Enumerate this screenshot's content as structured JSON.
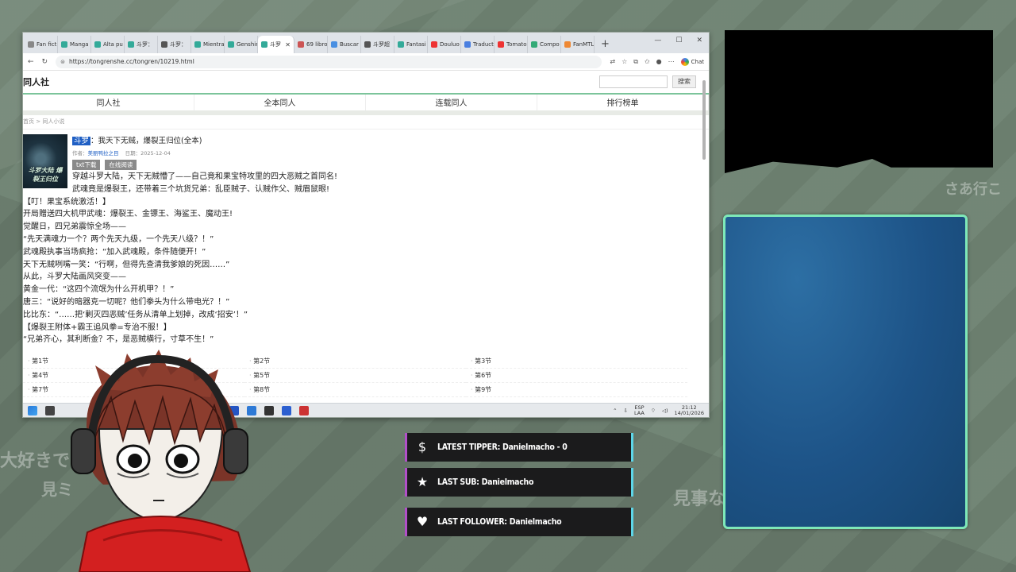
{
  "browser": {
    "tabs": [
      {
        "label": "Fan fict",
        "color": "#888"
      },
      {
        "label": "Manga",
        "color": "#3a9"
      },
      {
        "label": "Alta pu",
        "color": "#3a9"
      },
      {
        "label": "斗罗：",
        "color": "#3a9"
      },
      {
        "label": "斗罗：",
        "color": "#555"
      },
      {
        "label": "Mientra",
        "color": "#3a9"
      },
      {
        "label": "Genshin",
        "color": "#3a9"
      },
      {
        "label": "斗罗",
        "color": "#3a9",
        "active": true
      },
      {
        "label": "69 libro",
        "color": "#c55"
      },
      {
        "label": "Buscar",
        "color": "#4a90e2"
      },
      {
        "label": "斗罗超",
        "color": "#555"
      },
      {
        "label": "Fantasi",
        "color": "#3a9"
      },
      {
        "label": "Douluo",
        "color": "#e33"
      },
      {
        "label": "Traducto",
        "color": "#4a7fe0"
      },
      {
        "label": "Tomato",
        "color": "#e33"
      },
      {
        "label": "Compo",
        "color": "#3a7"
      },
      {
        "label": "FanMTL",
        "color": "#e83"
      }
    ],
    "new_tab": "+",
    "url": "https://tongrenshe.cc/tongren/10219.html",
    "chat_label": "Chat"
  },
  "site": {
    "logo": "同人社",
    "search_button": "搜索",
    "search_placeholder": "",
    "nav": [
      "同人社",
      "全本同人",
      "连载同人",
      "排行榜单"
    ],
    "breadcrumb": "首页 > 同人小说"
  },
  "book": {
    "tag": "斗罗",
    "title": "：我天下无贼，爆裂王归位(全本)",
    "meta_author_label": "作者：",
    "author": "美丽鸭拉之目",
    "meta_date": "日期：2025-12-04",
    "btn_download": "txt下载",
    "btn_read": "在线阅读",
    "cover_text": "斗罗大陆 爆裂王归位",
    "desc_inline": [
      "穿越斗罗大陆，天下无贼懵了——自己竟和果宝特攻里的四大恶贼之首同名!",
      "武魂竟是爆裂王，还带着三个坑货兄弟：乱臣贼子、认贼作父、贼眉鼠眼!"
    ],
    "desc": [
      "【叮！果宝系统激活！】",
      "开局赠送四大机甲武魂：爆裂王、金镖王、海鲨王、魔动王!",
      "觉醒日，四兄弟震惊全场——",
      "“先天满魂力一个？两个先天九级，一个先天八级？！”",
      "武魂殿执事当场疯抢：“加入武魂殿，条件随便开！”",
      "天下无贼咧嘴一笑：“行啊，但得先查清我爹娘的死因……”",
      "从此，斗罗大陆画风突变——",
      "黄金一代：“这四个流氓为什么开机甲？！”",
      "唐三：“说好的暗器克一切呢？他们拳头为什么带电光？！”",
      "比比东：“……把‘剿灭四恶贼’任务从清单上划掉，改成‘招安’！”",
      "【爆裂王附体+霸王追风拳=专治不服！】",
      "“兄弟齐心，其利断金？不，是恶贼横行，寸草不生！”"
    ],
    "chapters": [
      "第1节",
      "第2节",
      "第3节",
      "第4节",
      "第5节",
      "第6节",
      "第7节",
      "第8节",
      "第9节"
    ]
  },
  "taskbar": {
    "lang": "ESP",
    "lang2": "LAA",
    "time": "21:12",
    "date": "14/01/2026"
  },
  "overlay": {
    "bg_texts": [
      "大好きで",
      "見事な",
      "見ミ",
      "さあ行こ"
    ],
    "alerts": [
      {
        "icon": "dollar-icon",
        "glyph": "$",
        "text": "LATEST TIPPER: Danielmacho - 0"
      },
      {
        "icon": "star-icon",
        "glyph": "★",
        "text": "LAST SUB: Danielmacho"
      },
      {
        "icon": "heart-icon",
        "glyph": "♥",
        "text": "LAST FOLLOWER: Danielmacho"
      }
    ],
    "accent_left": "#b24fc9",
    "accent_right": "#5dd6e8",
    "panel_border": "#7ee8b8"
  }
}
